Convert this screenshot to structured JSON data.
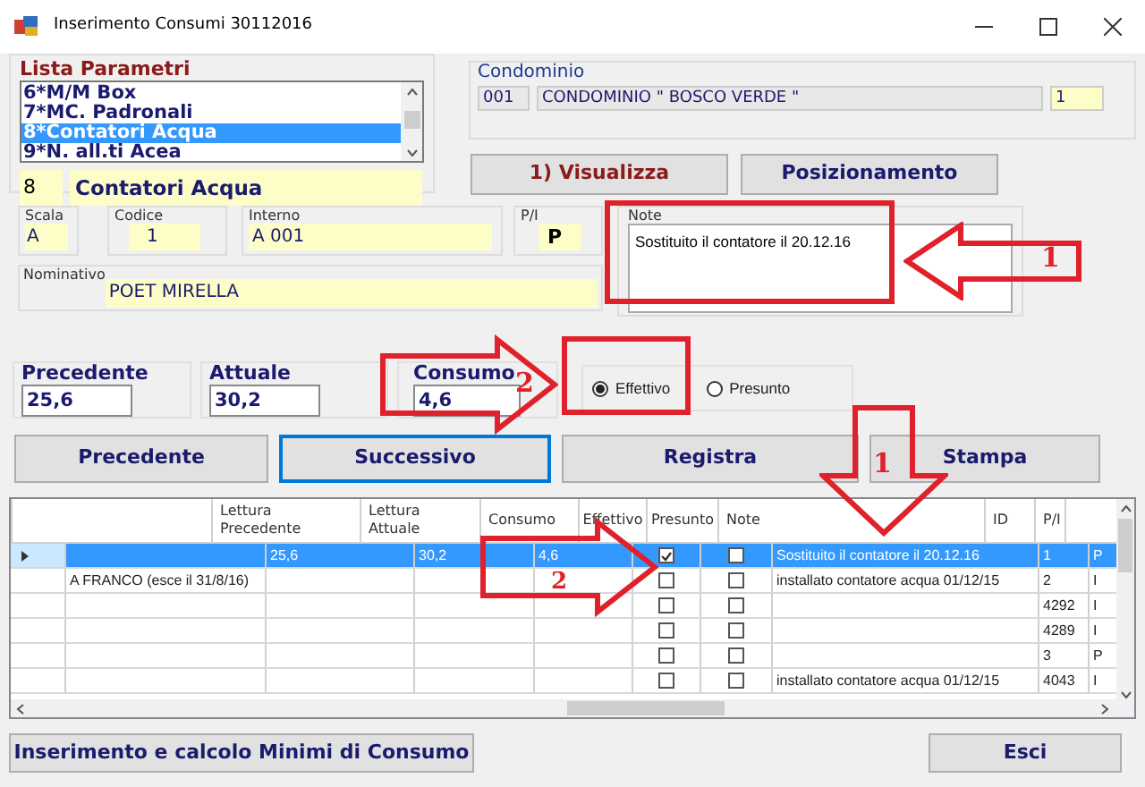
{
  "window": {
    "title": "Inserimento Consumi 30112016"
  },
  "lista_parametri": {
    "label": "Lista Parametri",
    "items": [
      {
        "label": "6*M/M Box",
        "selected": false
      },
      {
        "label": "7*MC. Padronali",
        "selected": false
      },
      {
        "label": "8*Contatori Acqua",
        "selected": true
      },
      {
        "label": "9*N. all.ti Acea",
        "selected": false
      }
    ],
    "code": "8",
    "name": "Contatori Acqua"
  },
  "condominio": {
    "label": "Condominio",
    "code": "001",
    "name": "CONDOMINIO \" BOSCO VERDE \"",
    "number": "1"
  },
  "top_buttons": [
    "1) Visualizza",
    "Posizionamento"
  ],
  "fields": {
    "scala": {
      "label": "Scala",
      "value": "A"
    },
    "codice": {
      "label": "Codice",
      "value": "1"
    },
    "interno": {
      "label": "Interno",
      "value": "A 001"
    },
    "pi": {
      "label": "P/I",
      "value": "P"
    },
    "nominativo": {
      "label": "Nominativo",
      "value": "POET MIRELLA"
    },
    "note": {
      "label": "Note",
      "value": "Sostituito il contatore il 20.12.16"
    }
  },
  "readings": [
    {
      "label": "Precedente",
      "value": "25,6"
    },
    {
      "label": "Attuale",
      "value": "30,2"
    },
    {
      "label": "Consumo",
      "value": "4,6"
    }
  ],
  "tipo": [
    {
      "label": "Effettivo",
      "selected": true
    },
    {
      "label": "Presunto",
      "selected": false
    }
  ],
  "nav_buttons": [
    {
      "label": "Precedente",
      "focused": false
    },
    {
      "label": "Successivo",
      "focused": true
    },
    {
      "label": "Registra",
      "focused": false
    },
    {
      "label": "Stampa",
      "focused": false
    }
  ],
  "table": {
    "columns": [
      "",
      "Lettura Precedente",
      "Lettura Attuale",
      "Consumo",
      "Effettivo",
      "Presunto",
      "Note",
      "ID",
      "P/I"
    ],
    "rows": [
      {
        "selected": true,
        "name": "",
        "prev": "25,6",
        "curr": "30,2",
        "consumo": "4,6",
        "effettivo": true,
        "presunto": false,
        "note": "Sostituito il contatore il 20.12.16",
        "id": "1",
        "pi": "P"
      },
      {
        "selected": false,
        "name": "A FRANCO (esce il 31/8/16)",
        "prev": "",
        "curr": "",
        "consumo": "",
        "effettivo": false,
        "presunto": false,
        "note": "installato contatore acqua 01/12/15",
        "id": "2",
        "pi": "I"
      },
      {
        "selected": false,
        "name": "",
        "prev": "",
        "curr": "",
        "consumo": "",
        "effettivo": false,
        "presunto": false,
        "note": "",
        "id": "4292",
        "pi": "I"
      },
      {
        "selected": false,
        "name": "",
        "prev": "",
        "curr": "",
        "consumo": "",
        "effettivo": false,
        "presunto": false,
        "note": "",
        "id": "4289",
        "pi": "I"
      },
      {
        "selected": false,
        "name": "",
        "prev": "",
        "curr": "",
        "consumo": "",
        "effettivo": false,
        "presunto": false,
        "note": "",
        "id": "3",
        "pi": "P"
      },
      {
        "selected": false,
        "name": "",
        "prev": "",
        "curr": "",
        "consumo": "",
        "effettivo": false,
        "presunto": false,
        "note": "installato contatore acqua 01/12/15",
        "id": "4043",
        "pi": "I"
      }
    ]
  },
  "bottom_buttons": [
    "Inserimento e calcolo Minimi di Consumo",
    "Esci"
  ],
  "annotations": [
    {
      "kind": "box"
    },
    {
      "kind": "arrow_left",
      "label": "1"
    },
    {
      "kind": "box"
    },
    {
      "kind": "arrow_right",
      "label": "2"
    },
    {
      "kind": "arrow_down",
      "label": "1"
    },
    {
      "kind": "arrow_right",
      "label": "2"
    }
  ]
}
